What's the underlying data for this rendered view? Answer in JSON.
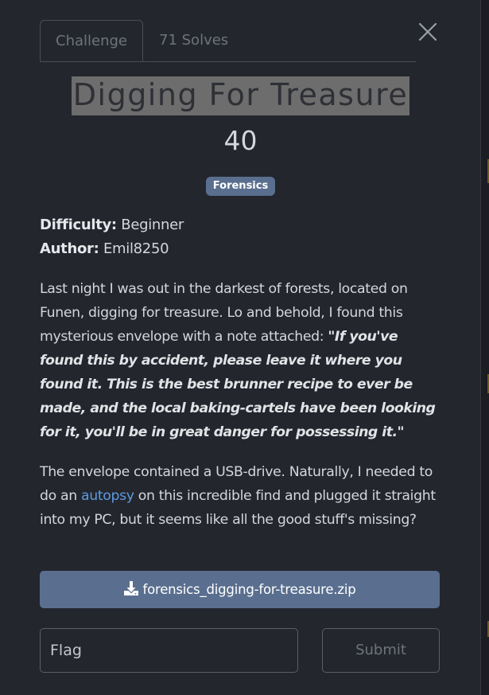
{
  "tabs": [
    {
      "label": "Challenge",
      "active": true
    },
    {
      "label": "71 Solves",
      "active": false
    }
  ],
  "close_icon": "close-icon",
  "challenge": {
    "title": "Digging For Treasure",
    "points": "40",
    "category": "Forensics",
    "difficulty_label": "Difficulty:",
    "difficulty_value": "Beginner",
    "author_label": "Author:",
    "author_value": "Emil8250"
  },
  "description": {
    "p1_text": "Last night I was out in the darkest of forests, located on Funen, digging for treasure. Lo and behold, I found this mysterious envelope with a note attached: ",
    "p1_quote": "\"If you've found this by accident, please leave it where you found it. This is the best brunner recipe to ever be made, and the local baking-cartels have been looking for it, you'll be in great danger for possessing it.\"",
    "p2_before": "The envelope contained a USB-drive. Naturally, I needed to do an ",
    "p2_link": "autopsy",
    "p2_after": " on this incredible find and plugged it straight into my PC, but it seems like all the good stuff's missing?"
  },
  "download": {
    "icon": "download-icon",
    "filename": "forensics_digging-for-treasure.zip"
  },
  "flag_form": {
    "placeholder": "Flag",
    "value": "",
    "submit_label": "Submit"
  },
  "colors": {
    "background": "#23262d",
    "accent": "#5a6f8f",
    "link": "#5d9ae0",
    "title_highlight": "#6d6d6d"
  }
}
